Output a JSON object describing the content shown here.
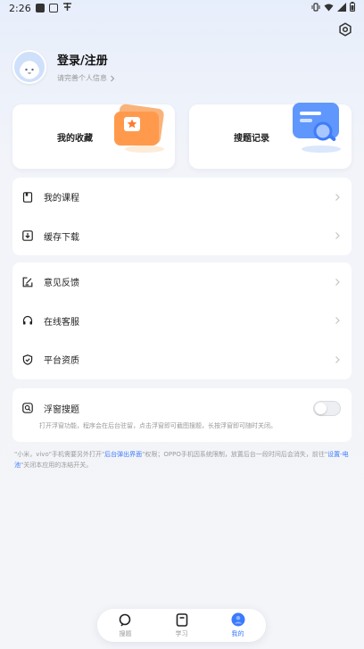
{
  "status": {
    "time": "2:26"
  },
  "profile": {
    "title": "登录/注册",
    "subtitle": "请完善个人信息"
  },
  "quick": {
    "favorites": "我的收藏",
    "records": "搜题记录"
  },
  "menu1": [
    "我的课程",
    "缓存下载"
  ],
  "menu2": [
    "意见反馈",
    "在线客服",
    "平台资质"
  ],
  "floating": {
    "label": "浮窗搜题",
    "desc": "打开浮窗功能，程序会在后台驻留，点击浮窗即可截图搜题，长按浮窗即可随时关闭。",
    "enabled": false
  },
  "note": {
    "p1": "\"小米，vivo\"手机需要另外打开\"",
    "h1": "后台弹出界面",
    "p2": "\"权限；OPPO手机因系统限制，放置后台一段时间后会消失，前往\"",
    "h2": "设置-电池",
    "p3": "\"关闭本应用的冻结开关。"
  },
  "nav": [
    {
      "label": "搜题",
      "icon": "search-chat-icon"
    },
    {
      "label": "学习",
      "icon": "book-icon"
    },
    {
      "label": "我的",
      "icon": "profile-icon",
      "active": true
    }
  ],
  "colors": {
    "accent": "#3a7afe",
    "background": "#f4f5f8",
    "card": "#ffffff"
  }
}
